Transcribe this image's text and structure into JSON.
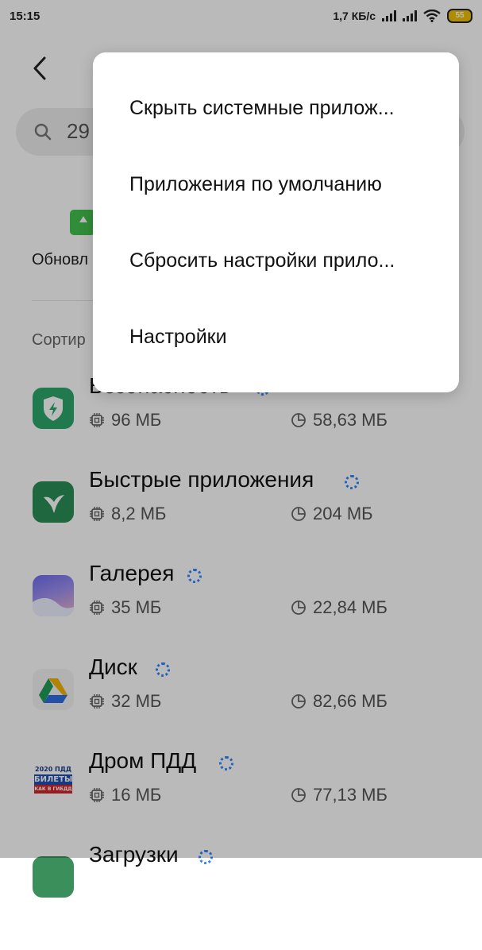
{
  "status_bar": {
    "time": "15:15",
    "speed": "1,7 КБ/с",
    "battery": "55"
  },
  "header": {
    "back_icon": "chevron-left-icon",
    "search_text": "29"
  },
  "update_tile": {
    "label": "Обновл"
  },
  "sort": {
    "label": "Сортир"
  },
  "apps": [
    {
      "name": "Безопасность",
      "memory": "96 МБ",
      "storage": "58,63 МБ",
      "icon": "security-shield-icon"
    },
    {
      "name": "Быстрые приложения",
      "memory": "8,2 МБ",
      "storage": "204 МБ",
      "icon": "quick-apps-bird-icon"
    },
    {
      "name": "Галерея",
      "memory": "35 МБ",
      "storage": "22,84 МБ",
      "icon": "gallery-icon"
    },
    {
      "name": "Диск",
      "memory": "32 МБ",
      "storage": "82,66 МБ",
      "icon": "google-drive-icon"
    },
    {
      "name": "Дром ПДД",
      "memory": "16 МБ",
      "storage": "77,13 МБ",
      "icon": "drom-pdd-icon",
      "icon_text": {
        "line1": "2020 ПДД",
        "line2": "БИЛЕТЫ",
        "line3": "КАК В ГИБДД"
      }
    },
    {
      "name": "Загрузки"
    }
  ],
  "menu": {
    "items": [
      {
        "label": "Скрыть системные прилож..."
      },
      {
        "label": "Приложения по умолчанию"
      },
      {
        "label": "Сбросить настройки прило..."
      },
      {
        "label": "Настройки"
      }
    ]
  },
  "colors": {
    "accent_blue": "#2f86ff",
    "security_green": "#2ea86a",
    "update_green": "#43c24d"
  }
}
